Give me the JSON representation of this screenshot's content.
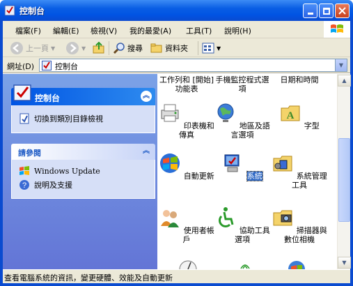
{
  "window": {
    "title": "控制台"
  },
  "menu": [
    "檔案(F)",
    "編輯(E)",
    "檢視(V)",
    "我的最愛(A)",
    "工具(T)",
    "說明(H)"
  ],
  "toolbar": {
    "back": "上一頁",
    "search": "搜尋",
    "folders": "資料夾"
  },
  "address": {
    "label": "網址(D)",
    "value": "控制台"
  },
  "left_panel": {
    "control_panel": {
      "title": "控制台",
      "link": "切換到類別目錄檢視"
    },
    "see_also": {
      "title": "請參閱",
      "links": [
        "Windows Update",
        "說明及支援"
      ]
    }
  },
  "items": [
    {
      "label": "工作列和 [開始] 功能表"
    },
    {
      "label": "手機監控程式選項"
    },
    {
      "label": "日期和時間"
    },
    {
      "label": "印表機和傳真"
    },
    {
      "label": "地區及語言選項"
    },
    {
      "label": "字型"
    },
    {
      "label": "自動更新"
    },
    {
      "label": "系統"
    },
    {
      "label": "系統管理工具"
    },
    {
      "label": "使用者帳戶"
    },
    {
      "label": "協助工具選項"
    },
    {
      "label": "掃描器與數位相機"
    }
  ],
  "status": {
    "text": "查看電腦系統的資訊，變更硬體、效能及自動更新"
  },
  "colors": {
    "titlebar": "#0054e3",
    "selection": "#316ac5",
    "panel": "#6375d6"
  }
}
